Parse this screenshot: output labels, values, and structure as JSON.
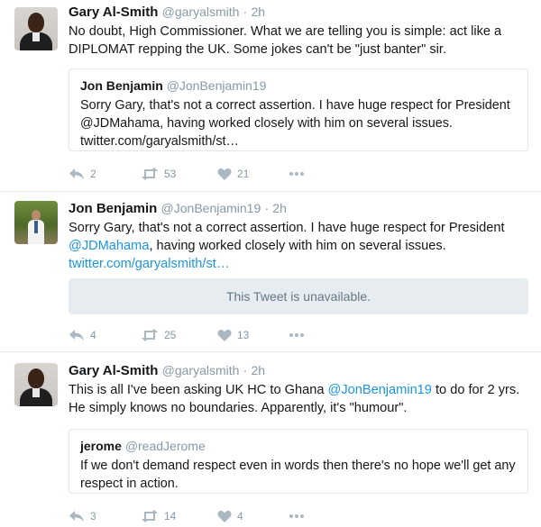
{
  "tweets": [
    {
      "name": "Gary Al-Smith",
      "handle": "@garyalsmith",
      "sep": "·",
      "time": "2h",
      "text": "No doubt, High Commissioner. What we are telling you is simple: act like a DIPLOMAT repping the UK. Some jokes can't be \"just banter\" sir.",
      "quote": {
        "name": "Jon Benjamin",
        "handle": "@JonBenjamin19",
        "text": "Sorry Gary, that's not a correct assertion. I have huge respect for President @JDMahama, having worked closely with him on several issues. twitter.com/garyalsmith/st…"
      },
      "replies": "2",
      "retweets": "53",
      "likes": "21"
    },
    {
      "name": "Jon Benjamin",
      "handle": "@JonBenjamin19",
      "sep": "·",
      "time": "2h",
      "text_line1": "Sorry Gary, that's not a correct assertion. I have huge respect for President",
      "mention": "@JDMahama",
      "text_line2_rest": ", having worked closely with him on several issues.",
      "link": "twitter.com/garyalsmith/st…",
      "unavailable": "This Tweet is unavailable.",
      "replies": "4",
      "retweets": "25",
      "likes": "13"
    },
    {
      "name": "Gary Al-Smith",
      "handle": "@garyalsmith",
      "sep": "·",
      "time": "2h",
      "text_pre": "This is all I've been asking UK HC to Ghana ",
      "mention": "@JonBenjamin19",
      "text_post": " to do for 2 yrs. He simply knows no boundaries. Apparently, it's \"humour\".",
      "quote": {
        "name": "jerome",
        "handle": "@readJerome",
        "text": "If we don't demand respect even in words then there's no hope we'll get any respect in action."
      },
      "replies": "3",
      "retweets": "14",
      "likes": "4"
    }
  ],
  "colors": {
    "link": "#1b95e0",
    "muted": "#8899a6",
    "border": "#e1e8ed"
  },
  "icons": [
    "reply-icon",
    "retweet-icon",
    "like-icon",
    "more-icon"
  ]
}
